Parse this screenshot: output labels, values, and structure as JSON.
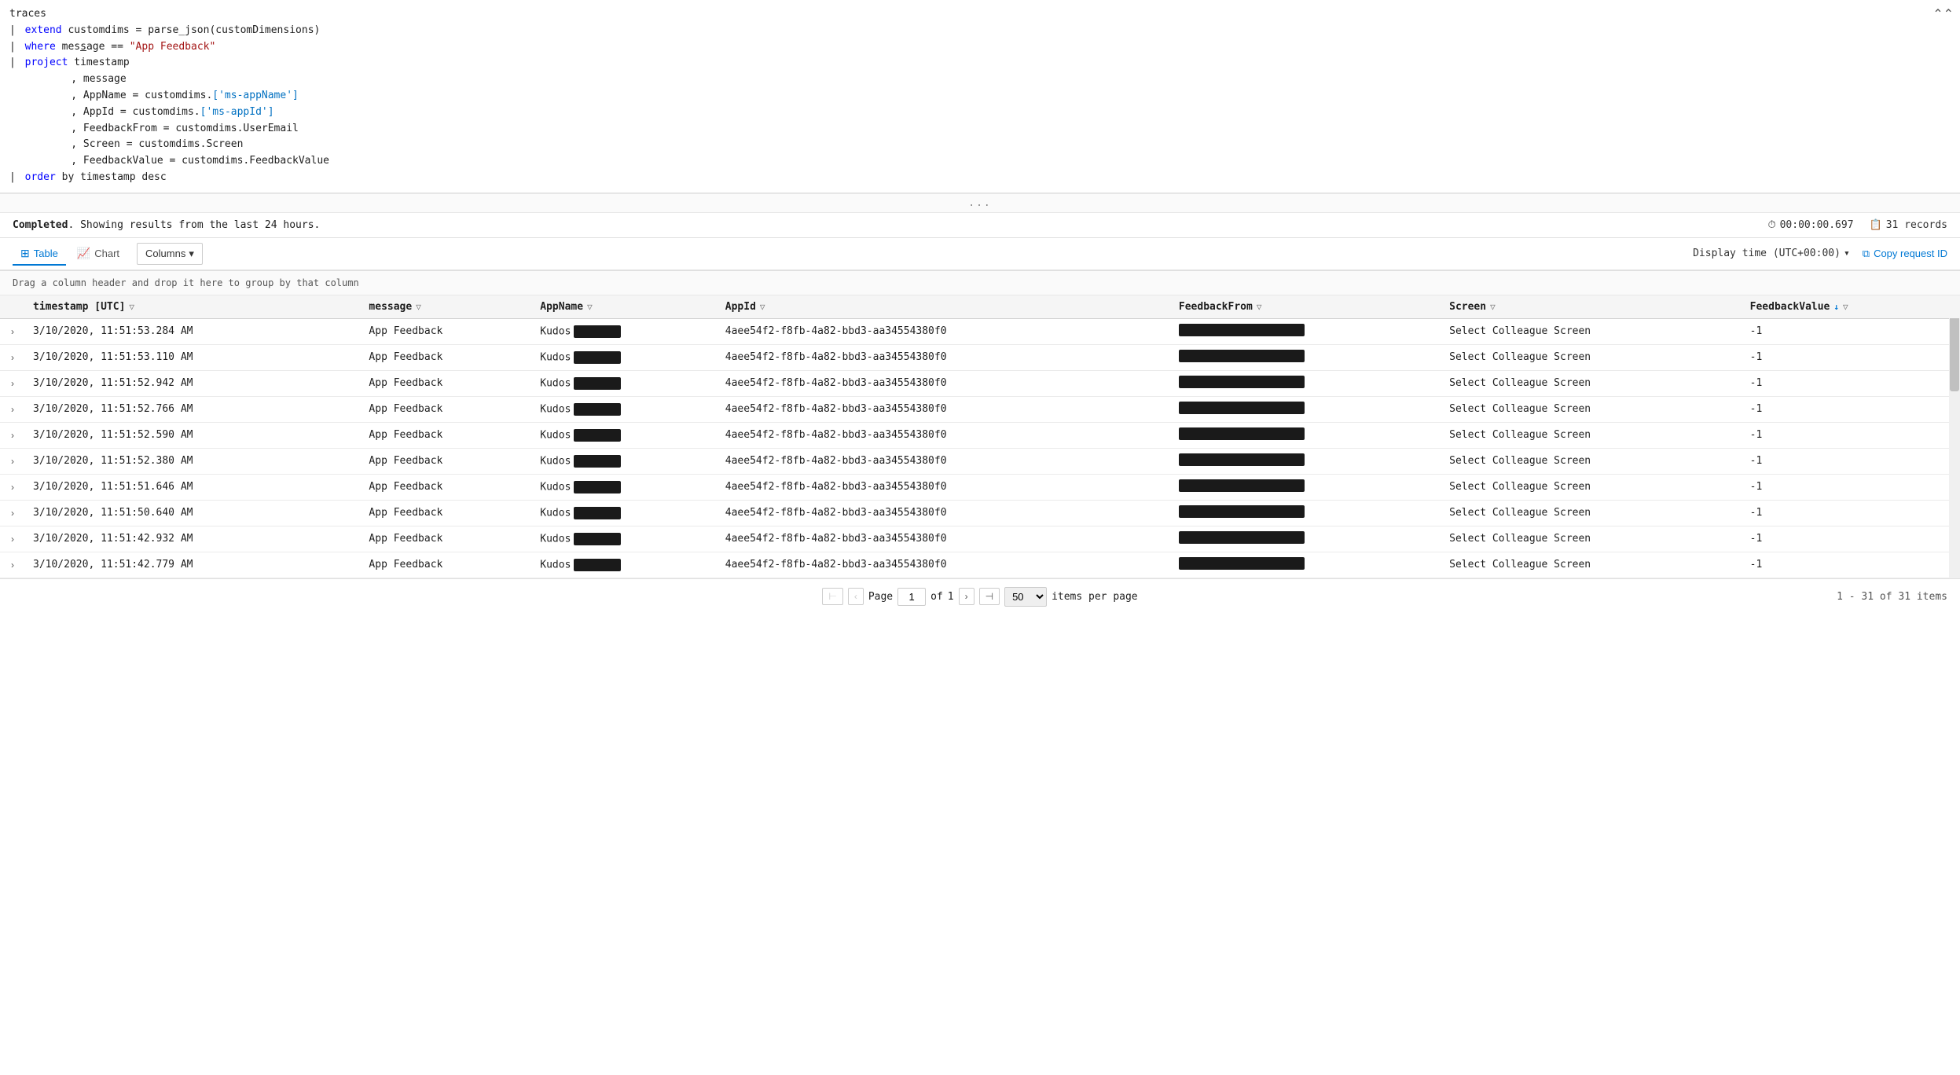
{
  "code": {
    "lines": [
      {
        "indent": 0,
        "pipe": null,
        "content": "traces"
      },
      {
        "indent": 1,
        "pipe": "|",
        "content": "extend customdims = parse_json(customDimensions)"
      },
      {
        "indent": 1,
        "pipe": "|",
        "content": "where message == \"App Feedback\""
      },
      {
        "indent": 1,
        "pipe": "|",
        "content": "project timestamp"
      },
      {
        "indent": 3,
        "pipe": null,
        "content": ", message"
      },
      {
        "indent": 3,
        "pipe": null,
        "content": ", AppName = customdims.['ms-appName']"
      },
      {
        "indent": 3,
        "pipe": null,
        "content": ", AppId = customdims.['ms-appId']"
      },
      {
        "indent": 3,
        "pipe": null,
        "content": ", FeedbackFrom = customdims.UserEmail"
      },
      {
        "indent": 3,
        "pipe": null,
        "content": ", Screen = customdims.Screen"
      },
      {
        "indent": 3,
        "pipe": null,
        "content": ", FeedbackValue = customdims.FeedbackValue"
      },
      {
        "indent": 1,
        "pipe": "|",
        "content": "order by timestamp desc"
      }
    ]
  },
  "status": {
    "completed_label": "Completed",
    "showing_text": ". Showing results from the last 24 hours.",
    "time_label": "00:00:00.697",
    "records_label": "31 records"
  },
  "toolbar": {
    "table_tab": "Table",
    "chart_tab": "Chart",
    "columns_btn": "Columns",
    "display_time": "Display time (UTC+00:00)",
    "copy_request": "Copy request ID"
  },
  "drag_hint": "Drag a column header and drop it here to group by that column",
  "columns": [
    {
      "name": "timestamp [UTC]",
      "key": "timestamp",
      "sortable": false,
      "filtered": true
    },
    {
      "name": "message",
      "key": "message",
      "sortable": false,
      "filtered": true
    },
    {
      "name": "AppName",
      "key": "appname",
      "sortable": false,
      "filtered": true
    },
    {
      "name": "AppId",
      "key": "appid",
      "sortable": false,
      "filtered": true
    },
    {
      "name": "FeedbackFrom",
      "key": "feedbackfrom",
      "sortable": false,
      "filtered": true
    },
    {
      "name": "Screen",
      "key": "screen",
      "sortable": false,
      "filtered": true
    },
    {
      "name": "FeedbackValue",
      "key": "feedbackvalue",
      "sortable": true,
      "filtered": true
    }
  ],
  "rows": [
    {
      "timestamp": "3/10/2020, 11:51:53.284 AM",
      "message": "App Feedback",
      "appname": "Kudos",
      "appname_redact": true,
      "appid": "4aee54f2-f8fb-4a82-bbd3-aa34554380f0",
      "feedbackfrom_redact": true,
      "screen": "Select Colleague Screen",
      "feedbackvalue": "-1"
    },
    {
      "timestamp": "3/10/2020, 11:51:53.110 AM",
      "message": "App Feedback",
      "appname": "Kudos",
      "appname_redact": true,
      "appid": "4aee54f2-f8fb-4a82-bbd3-aa34554380f0",
      "feedbackfrom_redact": true,
      "screen": "Select Colleague Screen",
      "feedbackvalue": "-1"
    },
    {
      "timestamp": "3/10/2020, 11:51:52.942 AM",
      "message": "App Feedback",
      "appname": "Kudos",
      "appname_redact": true,
      "appid": "4aee54f2-f8fb-4a82-bbd3-aa34554380f0",
      "feedbackfrom_redact": true,
      "screen": "Select Colleague Screen",
      "feedbackvalue": "-1"
    },
    {
      "timestamp": "3/10/2020, 11:51:52.766 AM",
      "message": "App Feedback",
      "appname": "Kudos",
      "appname_redact": true,
      "appid": "4aee54f2-f8fb-4a82-bbd3-aa34554380f0",
      "feedbackfrom_redact": true,
      "screen": "Select Colleague Screen",
      "feedbackvalue": "-1"
    },
    {
      "timestamp": "3/10/2020, 11:51:52.590 AM",
      "message": "App Feedback",
      "appname": "Kudos",
      "appname_redact": true,
      "appid": "4aee54f2-f8fb-4a82-bbd3-aa34554380f0",
      "feedbackfrom_redact": true,
      "screen": "Select Colleague Screen",
      "feedbackvalue": "-1"
    },
    {
      "timestamp": "3/10/2020, 11:51:52.380 AM",
      "message": "App Feedback",
      "appname": "Kudos",
      "appname_redact": true,
      "appid": "4aee54f2-f8fb-4a82-bbd3-aa34554380f0",
      "feedbackfrom_redact": true,
      "screen": "Select Colleague Screen",
      "feedbackvalue": "-1"
    },
    {
      "timestamp": "3/10/2020, 11:51:51.646 AM",
      "message": "App Feedback",
      "appname": "Kudos",
      "appname_redact": true,
      "appid": "4aee54f2-f8fb-4a82-bbd3-aa34554380f0",
      "feedbackfrom_redact": true,
      "screen": "Select Colleague Screen",
      "feedbackvalue": "-1"
    },
    {
      "timestamp": "3/10/2020, 11:51:50.640 AM",
      "message": "App Feedback",
      "appname": "Kudos",
      "appname_redact": true,
      "appid": "4aee54f2-f8fb-4a82-bbd3-aa34554380f0",
      "feedbackfrom_redact": true,
      "screen": "Select Colleague Screen",
      "feedbackvalue": "-1"
    },
    {
      "timestamp": "3/10/2020, 11:51:42.932 AM",
      "message": "App Feedback",
      "appname": "Kudos",
      "appname_redact": true,
      "appid": "4aee54f2-f8fb-4a82-bbd3-aa34554380f0",
      "feedbackfrom_redact": true,
      "screen": "Select Colleague Screen",
      "feedbackvalue": "-1"
    },
    {
      "timestamp": "3/10/2020, 11:51:42.779 AM",
      "message": "App Feedback",
      "appname": "Kudos",
      "appname_redact": true,
      "appid": "4aee54f2-f8fb-4a82-bbd3-aa34554380f0",
      "feedbackfrom_redact": true,
      "screen": "Select Colleague Screen",
      "feedbackvalue": "-1"
    }
  ],
  "pagination": {
    "page_label": "Page",
    "page_value": "1",
    "of_label": "of",
    "of_value": "1",
    "items_per_page_label": "items per page",
    "per_page_value": "50",
    "summary": "1 - 31 of 31 items"
  },
  "colors": {
    "accent": "#0078d4",
    "keyword_blue": "#0000ff",
    "string_red": "#a31515",
    "field_teal": "#001080",
    "bracket_blue": "#0070c1"
  }
}
